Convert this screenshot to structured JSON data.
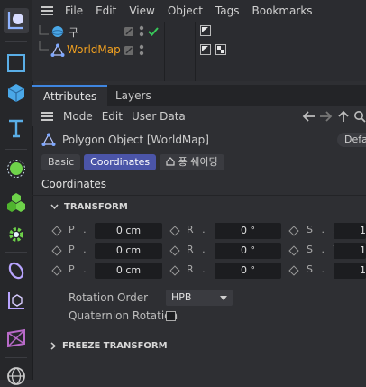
{
  "menubar": {
    "items": [
      "File",
      "Edit",
      "View",
      "Object",
      "Tags",
      "Bookmarks"
    ]
  },
  "objects": [
    {
      "name": "구",
      "color": "#c8c8c8",
      "checked": true
    },
    {
      "name": "WorldMap",
      "color": "#f0a020",
      "checked": false
    }
  ],
  "tabs": {
    "attributes": "Attributes",
    "layers": "Layers"
  },
  "attrbar": {
    "mode": "Mode",
    "edit": "Edit",
    "user_data": "User Data"
  },
  "object_title": "Polygon Object [WorldMap]",
  "default_btn": "Defa",
  "pills": {
    "basic": "Basic",
    "coordinates": "Coordinates",
    "phong": "퐁 쉐이딩"
  },
  "section_title": "Coordinates",
  "transform": {
    "title": "TRANSFORM",
    "pos": [
      {
        "label": "P . X",
        "value": "0 cm"
      },
      {
        "label": "P . Y",
        "value": "0 cm"
      },
      {
        "label": "P . Z",
        "value": "0 cm"
      }
    ],
    "rot": [
      {
        "label": "R . H",
        "value": "0 °"
      },
      {
        "label": "R . P",
        "value": "0 °"
      },
      {
        "label": "R . B",
        "value": "0 °"
      }
    ],
    "scale": [
      {
        "label": "S . X",
        "value": "1"
      },
      {
        "label": "S . Y",
        "value": "1"
      },
      {
        "label": "S . Z",
        "value": "1"
      }
    ]
  },
  "rotation_order": {
    "label": "Rotation Order",
    "value": "HPB"
  },
  "quaternion": {
    "label": "Quaternion Rotation",
    "checked": false
  },
  "freeze": {
    "title": "FREEZE TRANSFORM"
  },
  "colors": {
    "accent": "#3f86e0",
    "active_pill": "#4b55a8",
    "world_map": "#f0a020",
    "tool_blue": "#5aaee6",
    "tool_green": "#6ed24a",
    "tool_purple": "#b8a4ff"
  }
}
